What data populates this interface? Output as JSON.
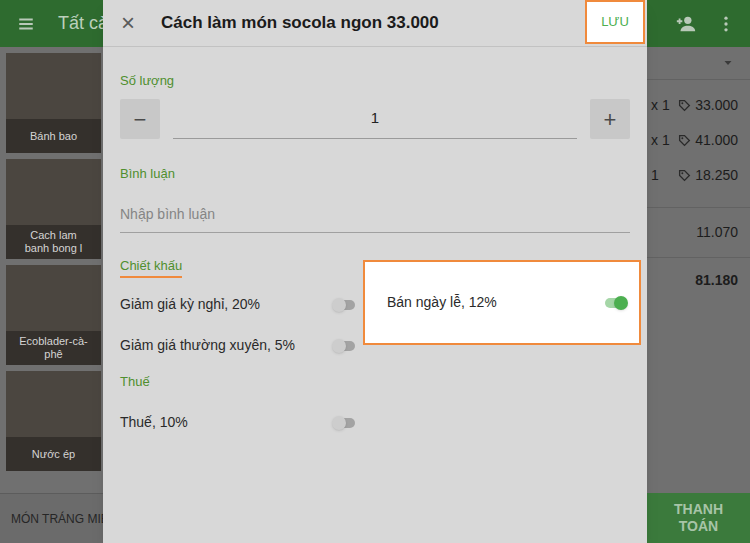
{
  "app_bar": {
    "title": "Tất cả"
  },
  "items": [
    {
      "name": "Bánh bao"
    },
    {
      "name": "Cach lam\nbanh bong l"
    },
    {
      "name": "Ecoblader-cà-\nphê"
    },
    {
      "name": "Nước ép"
    }
  ],
  "category": "MÓN TRÁNG MIỆ",
  "ticket": {
    "lines": [
      {
        "qty": "x 1",
        "price": "33.000"
      },
      {
        "qty": "x 1",
        "price": "41.000"
      },
      {
        "qty": "1",
        "price": "18.250"
      }
    ],
    "tax": "11.070",
    "total": "81.180"
  },
  "charge_button": "THANH TOÁN",
  "dialog": {
    "close": "×",
    "title": "Cách làm món socola ngon 33.000",
    "save": {
      "label": "LƯU",
      "highlighted": true
    },
    "quantity": {
      "label": "Số lượng",
      "minus": "−",
      "value": "1",
      "plus": "+"
    },
    "comment": {
      "label": "Bình luận",
      "placeholder": "Nhập bình luận"
    },
    "discounts": {
      "label": "Chiết khấu",
      "highlighted": true,
      "items": [
        {
          "name": "Giảm giá kỳ nghỉ, 20%",
          "on": false,
          "highlighted": false
        },
        {
          "name": "Giảm giá thường xuyên, 5%",
          "on": false,
          "highlighted": false
        },
        {
          "name": "Bán ngày lễ, 12%",
          "on": true,
          "highlighted": true
        }
      ]
    },
    "taxes": {
      "label": "Thuế",
      "items": [
        {
          "name": "Thuế, 10%",
          "on": false
        }
      ]
    }
  }
}
